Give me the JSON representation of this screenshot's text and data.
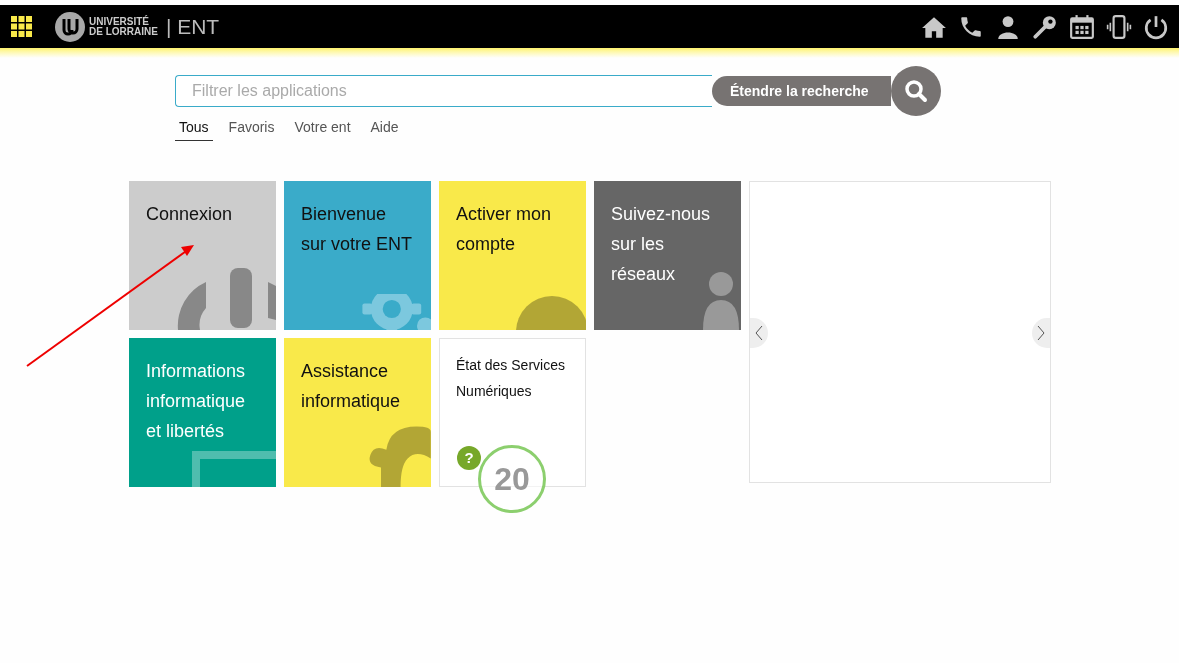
{
  "header": {
    "logo_line1": "UNIVERSITÉ",
    "logo_line2": "DE LORRAINE",
    "app_name": "| ENT"
  },
  "search": {
    "placeholder": "Filtrer les applications",
    "button": "Étendre la recherche"
  },
  "tabs": [
    {
      "label": "Tous",
      "selected": true
    },
    {
      "label": "Favoris",
      "selected": false
    },
    {
      "label": "Votre ent",
      "selected": false
    },
    {
      "label": "Aide",
      "selected": false
    }
  ],
  "tiles": [
    {
      "kind": "app",
      "title": "Connexion",
      "color": "#cccccc"
    },
    {
      "kind": "app",
      "title": "Bienvenue sur votre ENT",
      "color": "#3aabc9"
    },
    {
      "kind": "app",
      "title": "Activer mon compte",
      "color": "#f9e94a"
    },
    {
      "kind": "app",
      "title": "Suivez-nous sur les réseaux",
      "color": "#666666"
    },
    {
      "kind": "app",
      "title": "Informations informatique et libertés",
      "color": "#00a08a"
    },
    {
      "kind": "app",
      "title": "Assistance informatique",
      "color": "#f9e94a"
    },
    {
      "kind": "status",
      "title": "État des Services Numériques",
      "help": "?",
      "count": "20"
    }
  ]
}
